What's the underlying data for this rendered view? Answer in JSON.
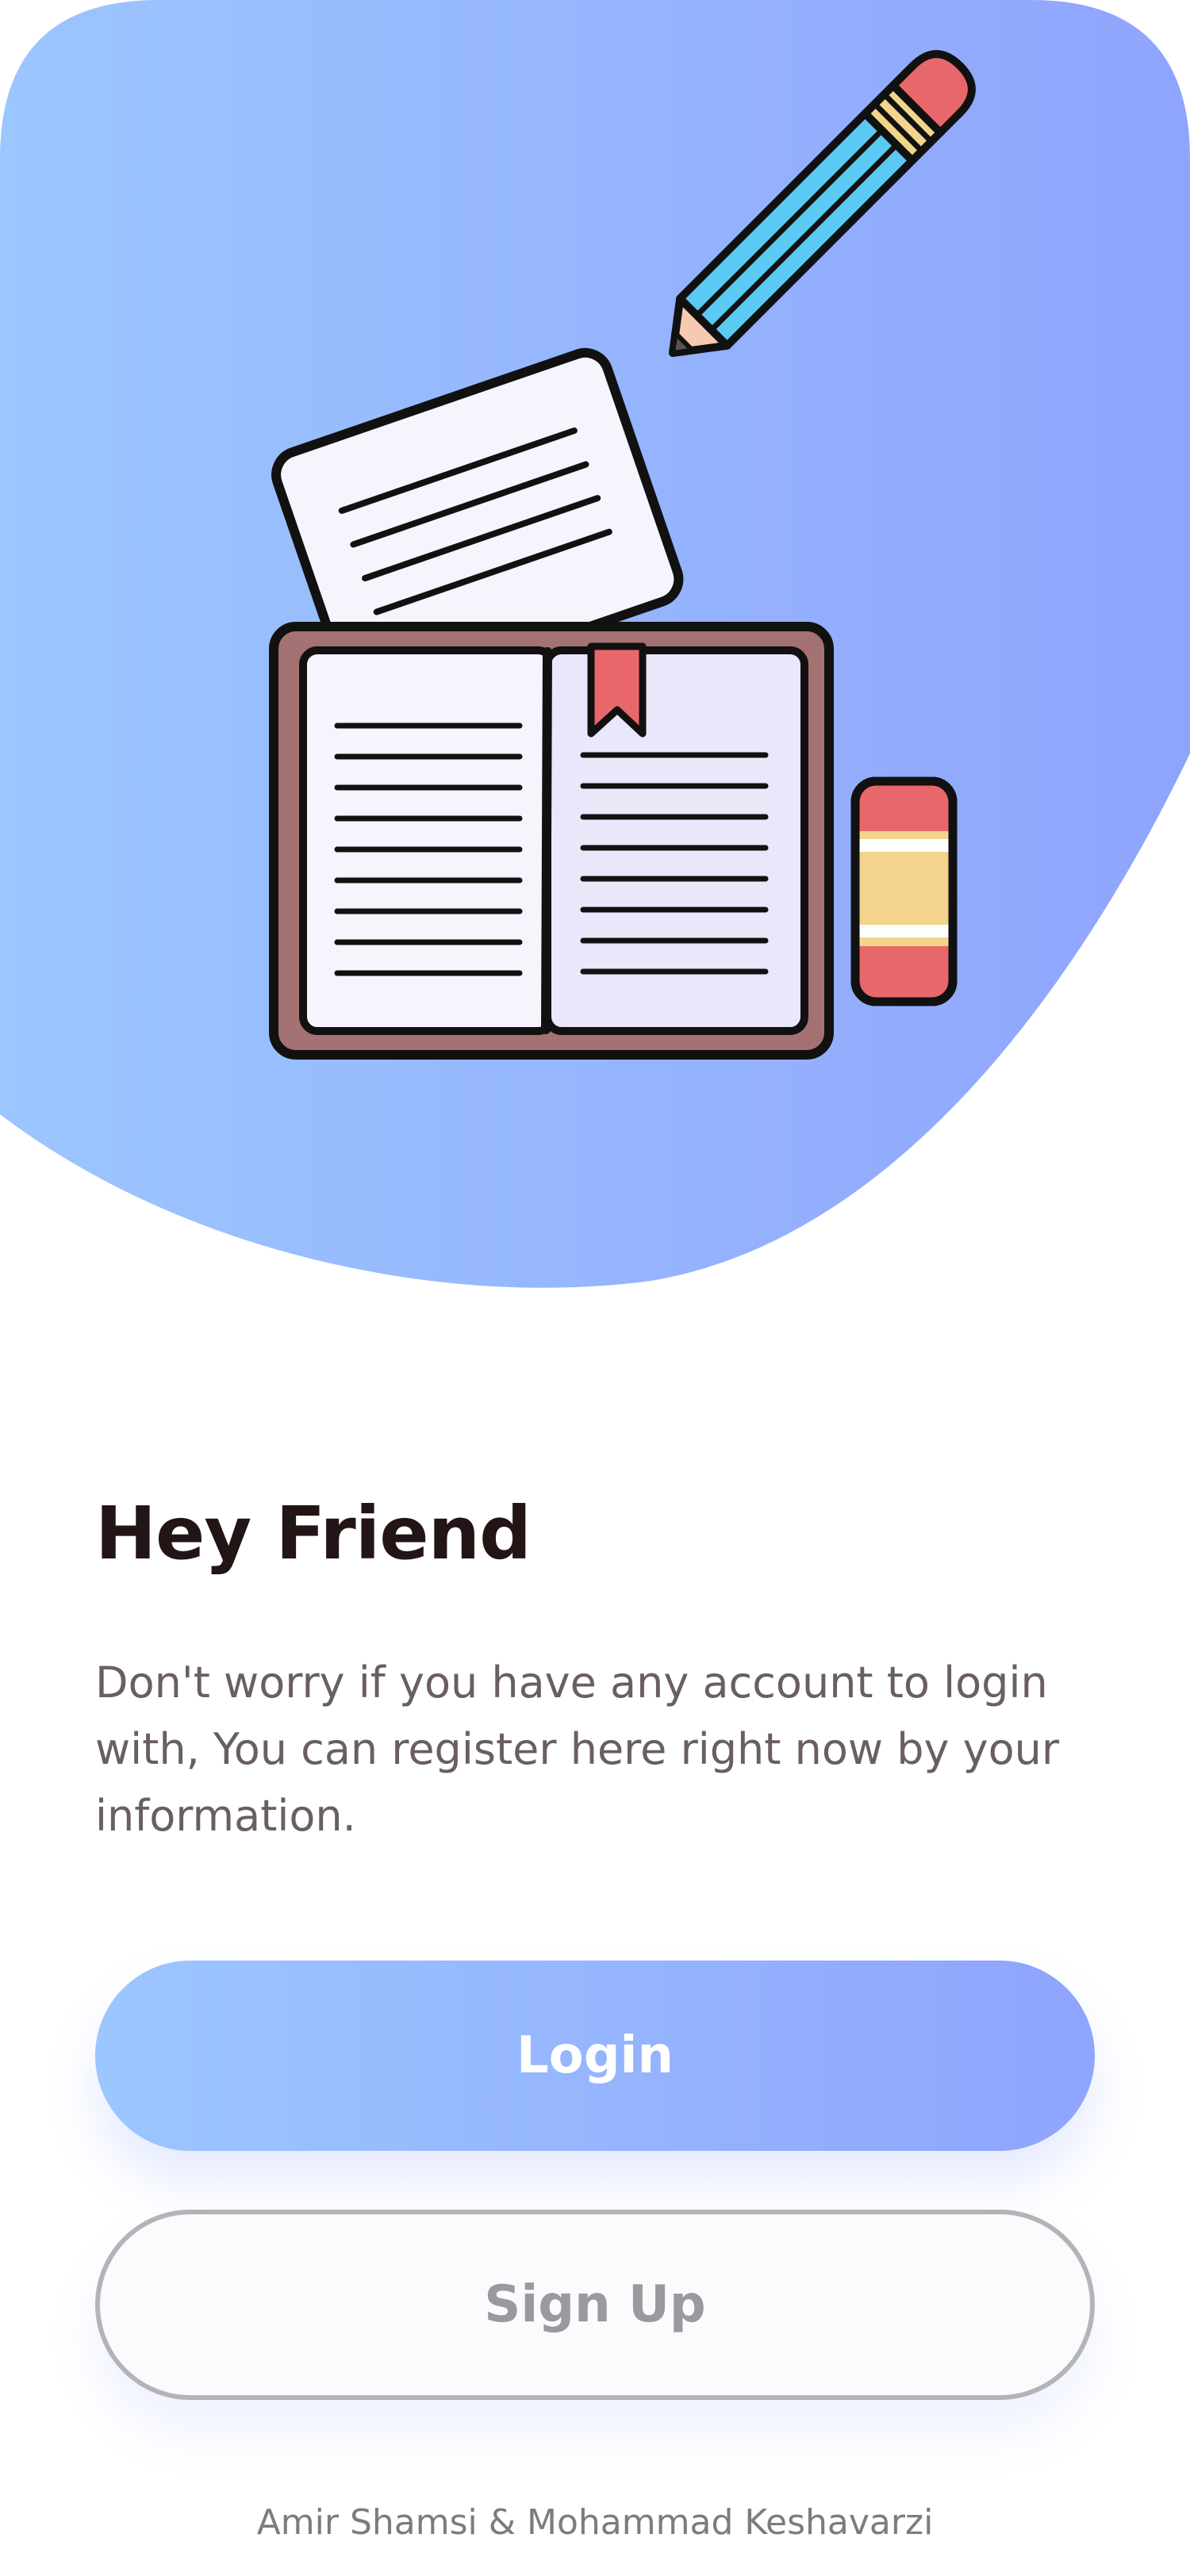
{
  "hero": {
    "illustration": "open-book-with-paper-pencil-eraser",
    "gradient_start": "#9cc6fe",
    "gradient_end": "#8fa4fd"
  },
  "welcome": {
    "title": "Hey Friend",
    "description": "Don't worry if you have any account to login with, You can register here right now by your information."
  },
  "actions": {
    "login_label": "Login",
    "signup_label": "Sign Up"
  },
  "footer": {
    "credit": "Amir Shamsi & Mohammad Keshavarzi"
  },
  "colors": {
    "title": "#231416",
    "body_text": "#6a5f60",
    "outline": "#b4b4b8"
  }
}
